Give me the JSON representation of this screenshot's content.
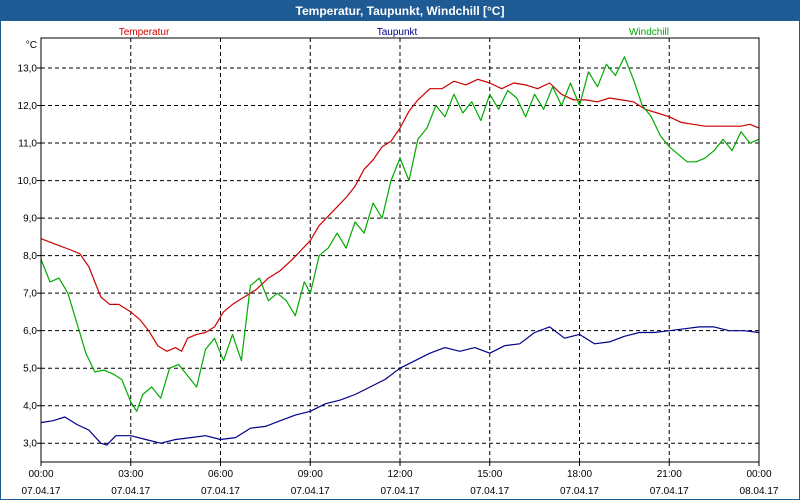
{
  "window": {
    "title": "Temperatur, Taupunkt, Windchill [°C]"
  },
  "chart_data": {
    "type": "line",
    "title": "Temperatur, Taupunkt, Windchill [°C]",
    "unit_label": "°C",
    "ylim": [
      2.5,
      13.8
    ],
    "y_ticks": [
      "3,0",
      "4,0",
      "5,0",
      "6,0",
      "7,0",
      "8,0",
      "9,0",
      "10,0",
      "11,0",
      "12,0",
      "13,0"
    ],
    "y_tick_values": [
      3,
      4,
      5,
      6,
      7,
      8,
      9,
      10,
      11,
      12,
      13
    ],
    "xlim": [
      0,
      24
    ],
    "x_tick_values": [
      0,
      3,
      6,
      9,
      12,
      15,
      18,
      21,
      24
    ],
    "x_tick_times": [
      "00:00",
      "03:00",
      "06:00",
      "09:00",
      "12:00",
      "15:00",
      "18:00",
      "21:00",
      "00:00"
    ],
    "x_tick_dates": [
      "07.04.17",
      "07.04.17",
      "07.04.17",
      "07.04.17",
      "07.04.17",
      "07.04.17",
      "07.04.17",
      "07.04.17",
      "08.04.17"
    ],
    "grid": true,
    "legend_placement": "top",
    "series": [
      {
        "name": "Temperatur",
        "color": "#cc0000",
        "x": [
          0,
          0.5,
          1,
          1.3,
          1.6,
          1.8,
          2,
          2.3,
          2.6,
          3,
          3.3,
          3.6,
          3.9,
          4.2,
          4.5,
          4.7,
          4.9,
          5.2,
          5.5,
          5.8,
          6.1,
          6.4,
          6.8,
          7.2,
          7.6,
          8,
          8.4,
          8.7,
          9,
          9.3,
          9.6,
          9.9,
          10.2,
          10.5,
          10.8,
          11.1,
          11.4,
          11.7,
          12,
          12.3,
          12.6,
          13,
          13.4,
          13.8,
          14.2,
          14.6,
          15,
          15.4,
          15.8,
          16.2,
          16.6,
          17,
          17.4,
          17.8,
          18.2,
          18.6,
          19,
          19.4,
          19.8,
          20.2,
          20.6,
          21,
          21.4,
          21.8,
          22.2,
          22.6,
          23,
          23.4,
          23.7,
          24
        ],
        "values": [
          8.45,
          8.3,
          8.15,
          8.05,
          7.7,
          7.3,
          6.9,
          6.7,
          6.7,
          6.5,
          6.3,
          6.0,
          5.6,
          5.45,
          5.55,
          5.45,
          5.8,
          5.9,
          5.95,
          6.1,
          6.5,
          6.7,
          6.9,
          7.1,
          7.4,
          7.6,
          7.9,
          8.15,
          8.4,
          8.8,
          9.05,
          9.3,
          9.55,
          9.85,
          10.3,
          10.55,
          10.9,
          11.05,
          11.4,
          11.85,
          12.15,
          12.45,
          12.45,
          12.65,
          12.55,
          12.7,
          12.6,
          12.45,
          12.6,
          12.55,
          12.45,
          12.6,
          12.3,
          12.15,
          12.15,
          12.1,
          12.2,
          12.15,
          12.1,
          11.9,
          11.8,
          11.7,
          11.55,
          11.5,
          11.45,
          11.45,
          11.45,
          11.45,
          11.5,
          11.4
        ]
      },
      {
        "name": "Taupunkt",
        "color": "#00008b",
        "x": [
          0,
          0.4,
          0.8,
          1.2,
          1.6,
          2,
          2.2,
          2.5,
          3,
          3.5,
          4,
          4.5,
          5,
          5.5,
          6,
          6.5,
          7,
          7.5,
          8,
          8.5,
          9,
          9.5,
          10,
          10.5,
          11,
          11.5,
          12,
          12.5,
          13,
          13.5,
          14,
          14.5,
          15,
          15.5,
          16,
          16.5,
          17,
          17.5,
          18,
          18.5,
          19,
          19.5,
          20,
          20.5,
          21,
          21.5,
          22,
          22.5,
          23,
          23.5,
          24
        ],
        "values": [
          3.55,
          3.6,
          3.7,
          3.5,
          3.35,
          3.0,
          2.95,
          3.2,
          3.2,
          3.1,
          3.0,
          3.1,
          3.15,
          3.2,
          3.1,
          3.15,
          3.4,
          3.45,
          3.6,
          3.75,
          3.85,
          4.05,
          4.15,
          4.3,
          4.5,
          4.7,
          5.0,
          5.2,
          5.4,
          5.55,
          5.45,
          5.55,
          5.4,
          5.6,
          5.65,
          5.95,
          6.1,
          5.8,
          5.9,
          5.65,
          5.7,
          5.85,
          5.95,
          5.95,
          6.0,
          6.05,
          6.1,
          6.1,
          6.0,
          6.0,
          5.95
        ]
      },
      {
        "name": "Windchill",
        "color": "#00aa00",
        "x": [
          0,
          0.3,
          0.6,
          0.9,
          1.2,
          1.5,
          1.8,
          2.1,
          2.4,
          2.7,
          3,
          3.2,
          3.4,
          3.7,
          4,
          4.3,
          4.6,
          4.9,
          5.2,
          5.5,
          5.8,
          6.1,
          6.4,
          6.7,
          7,
          7.3,
          7.6,
          7.9,
          8.2,
          8.5,
          8.8,
          9,
          9.3,
          9.6,
          9.9,
          10.2,
          10.5,
          10.8,
          11.1,
          11.4,
          11.7,
          12,
          12.3,
          12.6,
          12.9,
          13.2,
          13.5,
          13.8,
          14.1,
          14.4,
          14.7,
          15,
          15.3,
          15.6,
          15.9,
          16.2,
          16.5,
          16.8,
          17.1,
          17.4,
          17.7,
          18,
          18.3,
          18.6,
          18.9,
          19.2,
          19.5,
          19.8,
          20.1,
          20.4,
          20.7,
          21,
          21.3,
          21.6,
          21.9,
          22.2,
          22.5,
          22.8,
          23.1,
          23.4,
          23.7,
          24
        ],
        "values": [
          7.9,
          7.3,
          7.4,
          7.0,
          6.2,
          5.4,
          4.9,
          4.95,
          4.85,
          4.7,
          4.1,
          3.85,
          4.3,
          4.5,
          4.2,
          5.0,
          5.1,
          4.8,
          4.5,
          5.5,
          5.8,
          5.2,
          5.9,
          5.2,
          7.2,
          7.4,
          6.8,
          7.0,
          6.8,
          6.4,
          7.3,
          7.0,
          8.0,
          8.2,
          8.6,
          8.2,
          8.9,
          8.6,
          9.4,
          9.0,
          10.0,
          10.6,
          10.0,
          11.1,
          11.4,
          12.0,
          11.7,
          12.3,
          11.8,
          12.1,
          11.6,
          12.3,
          11.9,
          12.4,
          12.2,
          11.7,
          12.3,
          11.9,
          12.5,
          12.0,
          12.6,
          12.0,
          12.9,
          12.5,
          13.1,
          12.8,
          13.3,
          12.7,
          12.0,
          11.7,
          11.2,
          10.9,
          10.7,
          10.5,
          10.5,
          10.6,
          10.8,
          11.1,
          10.8,
          11.3,
          11.0,
          11.1
        ]
      }
    ]
  }
}
